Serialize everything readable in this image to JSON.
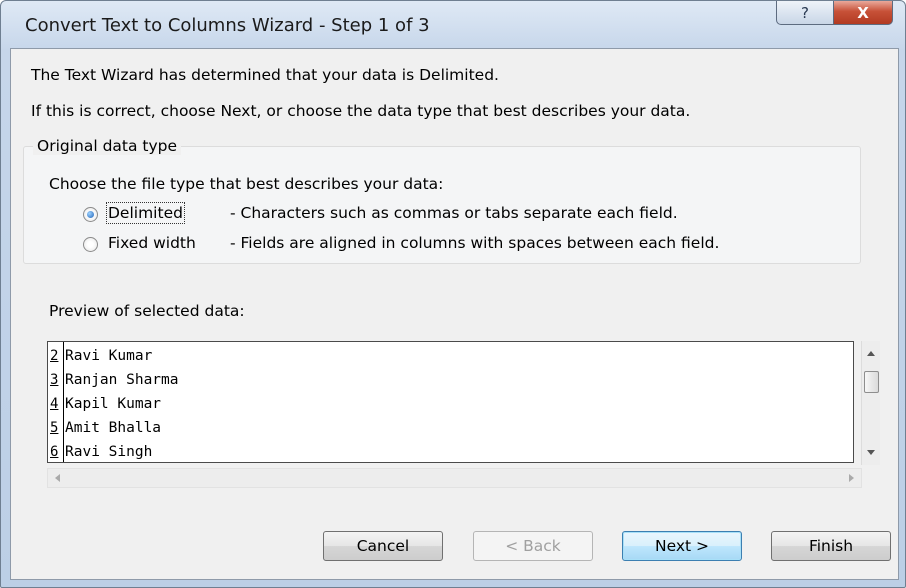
{
  "window": {
    "title": "Convert Text to Columns Wizard - Step 1 of 3",
    "help_glyph": "?",
    "close_glyph": "X"
  },
  "intro": {
    "line1": "The Text Wizard has determined that your data is Delimited.",
    "line2": "If this is correct, choose Next, or choose the data type that best describes your data."
  },
  "original_data_type": {
    "legend": "Original data type",
    "prompt": "Choose the file type that best describes your data:",
    "options": [
      {
        "label": "Delimited",
        "description": "- Characters such as commas or tabs separate each field.",
        "selected": true
      },
      {
        "label": "Fixed width",
        "description": "- Fields are aligned in columns with spaces between each field.",
        "selected": false
      }
    ]
  },
  "preview": {
    "label": "Preview of selected data:",
    "rows": [
      {
        "num": "2",
        "text": "Ravi Kumar"
      },
      {
        "num": "3",
        "text": "Ranjan Sharma"
      },
      {
        "num": "4",
        "text": "Kapil Kumar"
      },
      {
        "num": "5",
        "text": "Amit Bhalla"
      },
      {
        "num": "6",
        "text": "Ravi Singh"
      }
    ]
  },
  "buttons": {
    "cancel": "Cancel",
    "back": "< Back",
    "next": "Next >",
    "finish": "Finish"
  }
}
